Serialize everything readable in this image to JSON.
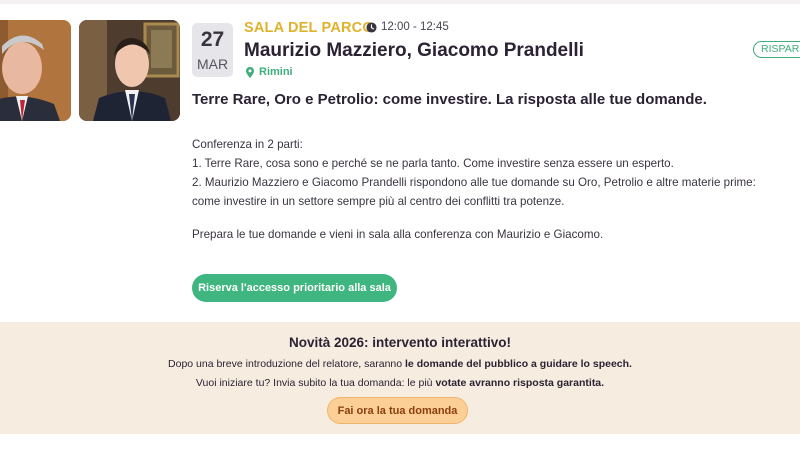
{
  "event": {
    "date": {
      "day": "27",
      "month": "MAR"
    },
    "venue": "SALA DEL PARCO",
    "time": "12:00 - 12:45",
    "speakers": "Maurizio Mazziero, Giacomo Prandelli",
    "location": "Rimini",
    "badge": "RISPARMIO",
    "title": "Terre Rare, Oro e Petrolio: come investire. La risposta alle tue domande.",
    "description": [
      "Conferenza in 2 parti:",
      "1. Terre Rare, cosa sono e perché se ne parla tanto. Come investire senza essere un esperto.",
      "2. Maurizio Mazziero e Giacomo Prandelli rispondono alle tue domande su Oro, Petrolio e altre materie prime:",
      "come investire in un settore sempre più al centro dei conflitti tra potenze.",
      "Prepara le tue domande e vieni in sala alla conferenza con Maurizio e Giacomo."
    ],
    "reserve_button": "Riserva l'accesso prioritario alla sala"
  },
  "promo": {
    "title": "Novità 2026: intervento interattivo!",
    "line1_pre": "Dopo una breve introduzione del relatore, saranno ",
    "line1_bold": "le domande del pubblico a guidare lo speech.",
    "line2_pre": "Vuoi iniziare tu? Invia subito la tua domanda: le più ",
    "line2_bold": "votate avranno risposta garantita.",
    "button": "Fai ora la tua domanda"
  },
  "icons": {
    "time": "clock-icon",
    "location": "map-pin-icon"
  },
  "colors": {
    "venue": "#e0b22c",
    "accent_green": "#3fb57f",
    "promo_bg": "#f6ede0",
    "promo_button": "#fbcf96"
  }
}
